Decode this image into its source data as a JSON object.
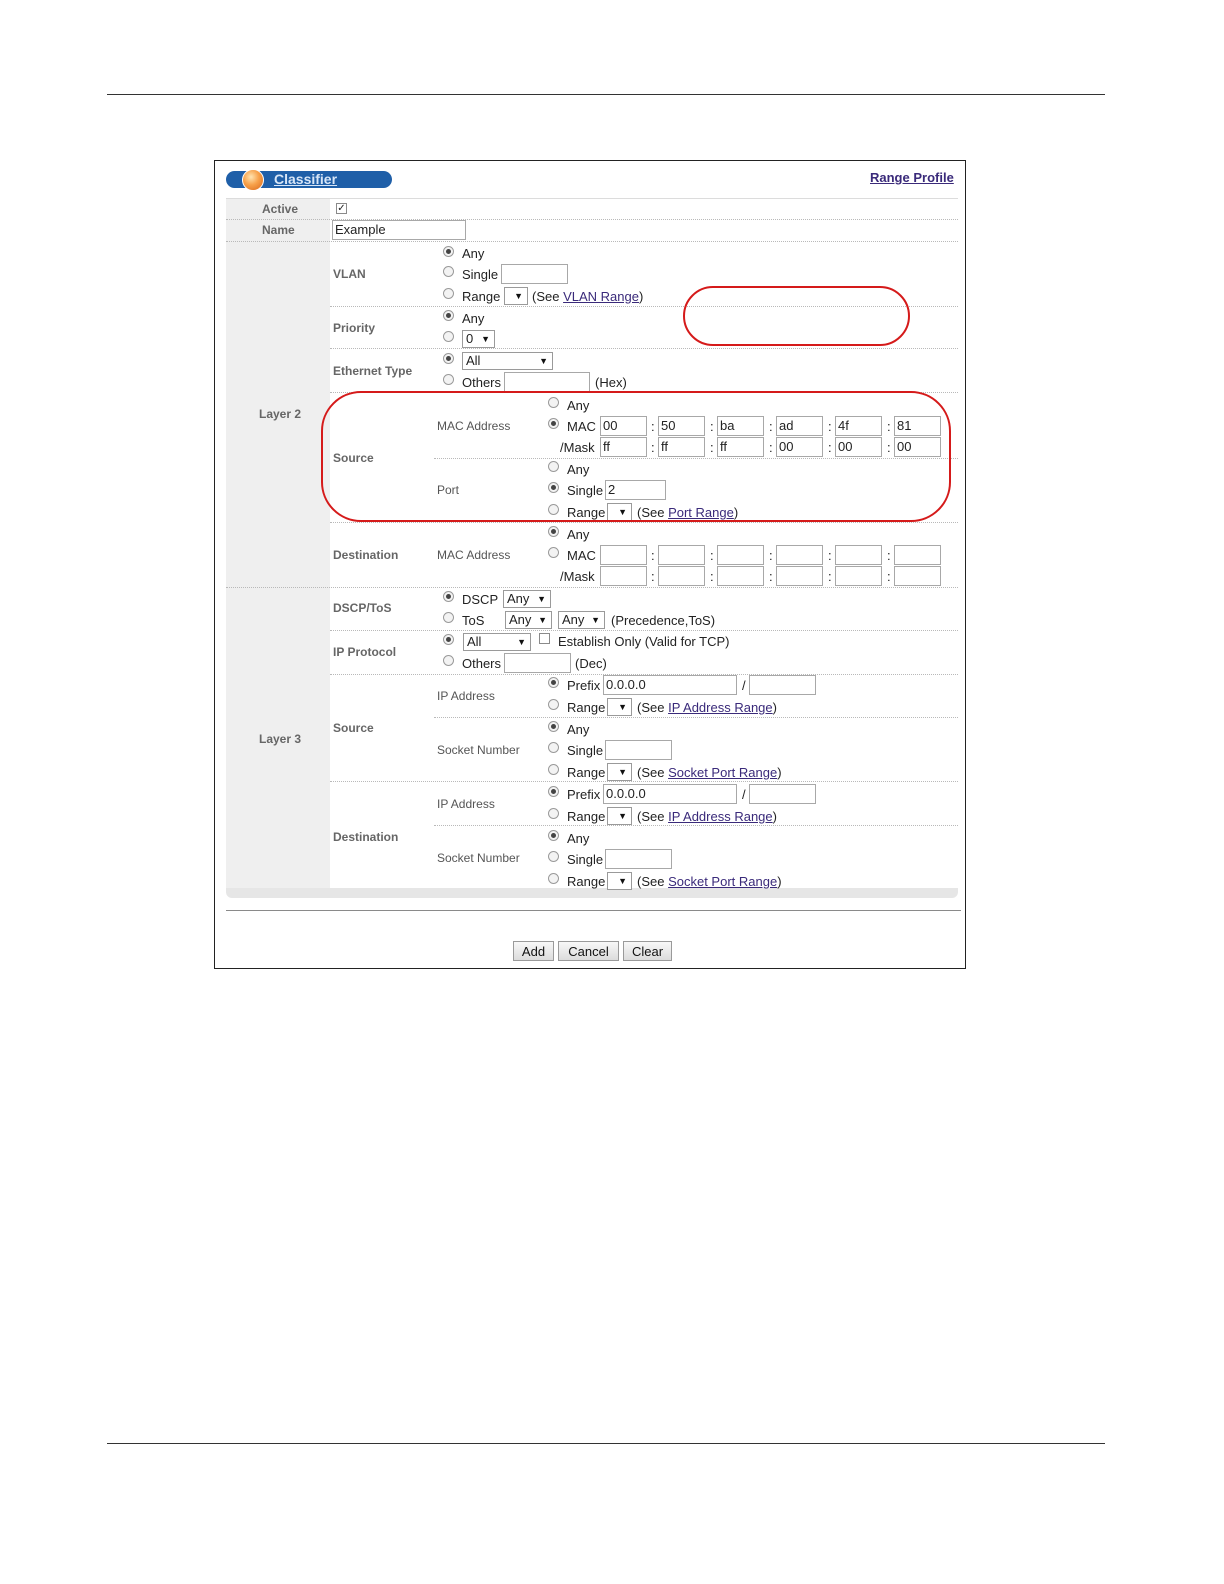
{
  "header": {
    "title": "Classifier",
    "range_profile_link": "Range Profile"
  },
  "rows": {
    "active": "Active",
    "name": "Name",
    "name_value": "Example"
  },
  "groups": {
    "layer2": "Layer 2",
    "layer3": "Layer 3",
    "source": "Source",
    "destination": "Destination"
  },
  "vlan": {
    "label": "VLAN",
    "any": "Any",
    "single": "Single",
    "range": "Range",
    "see": "(See ",
    "link": "VLAN Range",
    "close": ")"
  },
  "priority": {
    "label": "Priority",
    "any": "Any",
    "value": "0"
  },
  "ethertype": {
    "label": "Ethernet Type",
    "selected": "All",
    "others": "Others",
    "hex": "(Hex)"
  },
  "l2_source": {
    "mac_label": "MAC Address",
    "any": "Any",
    "mac": "MAC",
    "mask": "/Mask",
    "mac_values": [
      "00",
      "50",
      "ba",
      "ad",
      "4f",
      "81"
    ],
    "mask_values": [
      "ff",
      "ff",
      "ff",
      "00",
      "00",
      "00"
    ],
    "port_label": "Port",
    "port_any": "Any",
    "port_single": "Single",
    "port_value": "2",
    "port_range": "Range",
    "see": "(See ",
    "link": "Port Range",
    "close": ")"
  },
  "l2_dest": {
    "mac_label": "MAC Address",
    "any": "Any",
    "mac": "MAC",
    "mask": "/Mask"
  },
  "dscp": {
    "label": "DSCP/ToS",
    "dscp": "DSCP",
    "dscp_value": "Any",
    "tos": "ToS",
    "tos_value1": "Any",
    "tos_value2": "Any",
    "tos_note": "(Precedence,ToS)"
  },
  "ip_protocol": {
    "label": "IP Protocol",
    "selected": "All",
    "establish": "Establish Only (Valid for TCP)",
    "others": "Others",
    "dec": "(Dec)"
  },
  "l3_source": {
    "ip_label": "IP Address",
    "prefix": "Prefix",
    "prefix_value": "0.0.0.0",
    "slash": "/",
    "range": "Range",
    "see": "(See ",
    "ip_link": "IP Address Range",
    "close": ")",
    "socket_label": "Socket Number",
    "any": "Any",
    "single": "Single",
    "socket_link": "Socket Port Range"
  },
  "l3_dest": {
    "ip_label": "IP Address",
    "prefix": "Prefix",
    "prefix_value": "0.0.0.0",
    "slash": "/",
    "range": "Range",
    "see": "(See ",
    "ip_link": "IP Address Range",
    "close": ")",
    "socket_label": "Socket Number",
    "any": "Any",
    "single": "Single",
    "socket_link": "Socket Port Range"
  },
  "buttons": {
    "add": "Add",
    "cancel": "Cancel",
    "clear": "Clear"
  },
  "colors": {
    "title_bar": "#1f5fa8",
    "link": "#3a2a7a",
    "highlight": "#d51a1a",
    "label_bg": "#efefef"
  }
}
